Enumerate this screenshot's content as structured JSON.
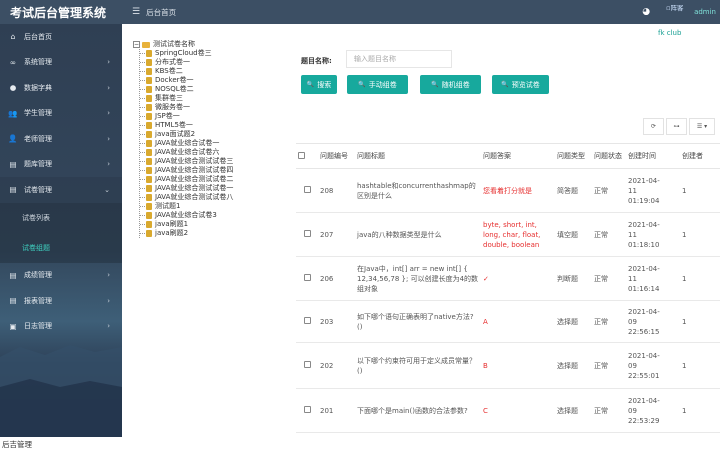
{
  "header": {
    "title": "考试后台管理系统",
    "nav_label": "后台首页",
    "avatar_alt": "阵客",
    "user": "admin",
    "club": "fk club"
  },
  "sidebar": {
    "items": [
      {
        "label": "后台首页",
        "icon": "home-icon",
        "glyph": "⌂",
        "arrow": ""
      },
      {
        "label": "系统管理",
        "icon": "link-icon",
        "glyph": "∞",
        "arrow": "›"
      },
      {
        "label": "数据字典",
        "icon": "disc-icon",
        "glyph": "●",
        "arrow": "›"
      },
      {
        "label": "学生管理",
        "icon": "users-icon",
        "glyph": "👥",
        "arrow": "›"
      },
      {
        "label": "老师管理",
        "icon": "teacher-icon",
        "glyph": "👤",
        "arrow": "›"
      },
      {
        "label": "题库管理",
        "icon": "file-icon",
        "glyph": "▤",
        "arrow": "›"
      },
      {
        "label": "试卷管理",
        "icon": "paper-icon",
        "glyph": "▤",
        "arrow": "⌄"
      }
    ],
    "submenu": [
      {
        "label": "试卷列表",
        "active": false
      },
      {
        "label": "试卷组题",
        "active": true
      }
    ],
    "bottom_items": [
      {
        "label": "成绩管理",
        "icon": "score-icon",
        "glyph": "▤",
        "arrow": "›"
      },
      {
        "label": "报表管理",
        "icon": "report-icon",
        "glyph": "▤",
        "arrow": "›"
      },
      {
        "label": "日志管理",
        "icon": "log-icon",
        "glyph": "▣",
        "arrow": "›"
      }
    ]
  },
  "tree": {
    "root": "测试试卷名称",
    "children": [
      "SpringCloud卷三",
      "分布式卷一",
      "KBS卷二",
      "Docker卷一",
      "NOSQL卷二",
      "集群卷三",
      "微服务卷一",
      "JSP卷一",
      "HTML5卷一",
      "java面试题2",
      "JAVA就业综合试卷一",
      "JAVA就业综合试卷六",
      "JAVA就业综合测试试卷三",
      "JAVA就业综合测试试卷四",
      "JAVA就业综合测试试卷二",
      "JAVA就业综合测试试卷一",
      "JAVA就业综合测试试卷八",
      "测试题1",
      "JAVA就业综合试卷3",
      "java刷题1",
      "java刷题2"
    ]
  },
  "search": {
    "label": "题目名称:",
    "placeholder": "输入题目名称",
    "value": ""
  },
  "buttons": {
    "search": "搜索",
    "manual": "手动组卷",
    "random": "随机组卷",
    "preview": "预览试卷"
  },
  "toolbar": {
    "refresh": "⟳",
    "toggle": "⊶",
    "columns": "☰ ▾"
  },
  "table": {
    "headers": [
      "",
      "问题编号",
      "问题标题",
      "问题答案",
      "问题类型",
      "问题状态",
      "创建时间",
      "创建者"
    ],
    "rows": [
      {
        "id": "208",
        "title": "hashtable和concurrenthashmap的区别是什么",
        "answer": "您看着打分就是",
        "type": "简答题",
        "status": "正常",
        "time": [
          "2021-04-",
          "11",
          "01:19:04"
        ],
        "creator": "1"
      },
      {
        "id": "207",
        "title": "java的八种数据类型是什么",
        "answer": "byte, short, int, long, char, float, double, boolean",
        "type": "填空题",
        "status": "正常",
        "time": [
          "2021-04-",
          "11",
          "01:18:10"
        ],
        "creator": "1"
      },
      {
        "id": "206",
        "title": "在Java中，int[] arr = new int[] { 12,34,56,78 }; 可以创建长度为4的数组对象",
        "answer": "✓",
        "type": "判断题",
        "status": "正常",
        "time": [
          "2021-04-",
          "11",
          "01:16:14"
        ],
        "creator": "1"
      },
      {
        "id": "203",
        "title": "如下哪个语句正确表明了native方法?()",
        "answer": "A",
        "type": "选择题",
        "status": "正常",
        "time": [
          "2021-04-",
          "09",
          "22:56:15"
        ],
        "creator": "1"
      },
      {
        "id": "202",
        "title": "以下哪个约束符可用于定义成员常量？ ()",
        "answer": "B",
        "type": "选择题",
        "status": "正常",
        "time": [
          "2021-04-",
          "09",
          "22:55:01"
        ],
        "creator": "1"
      },
      {
        "id": "201",
        "title": "下面哪个是main()函数的合法参数?",
        "answer": "C",
        "type": "选择题",
        "status": "正常",
        "time": [
          "2021-04-",
          "09",
          "22:53:29"
        ],
        "creator": "1"
      }
    ]
  },
  "status_bar": "后吉管理",
  "colors": {
    "header": "#3c4f64",
    "accent": "#17a99d",
    "answer": "#e62f2f",
    "active_submenu": "#3fd2c2"
  }
}
